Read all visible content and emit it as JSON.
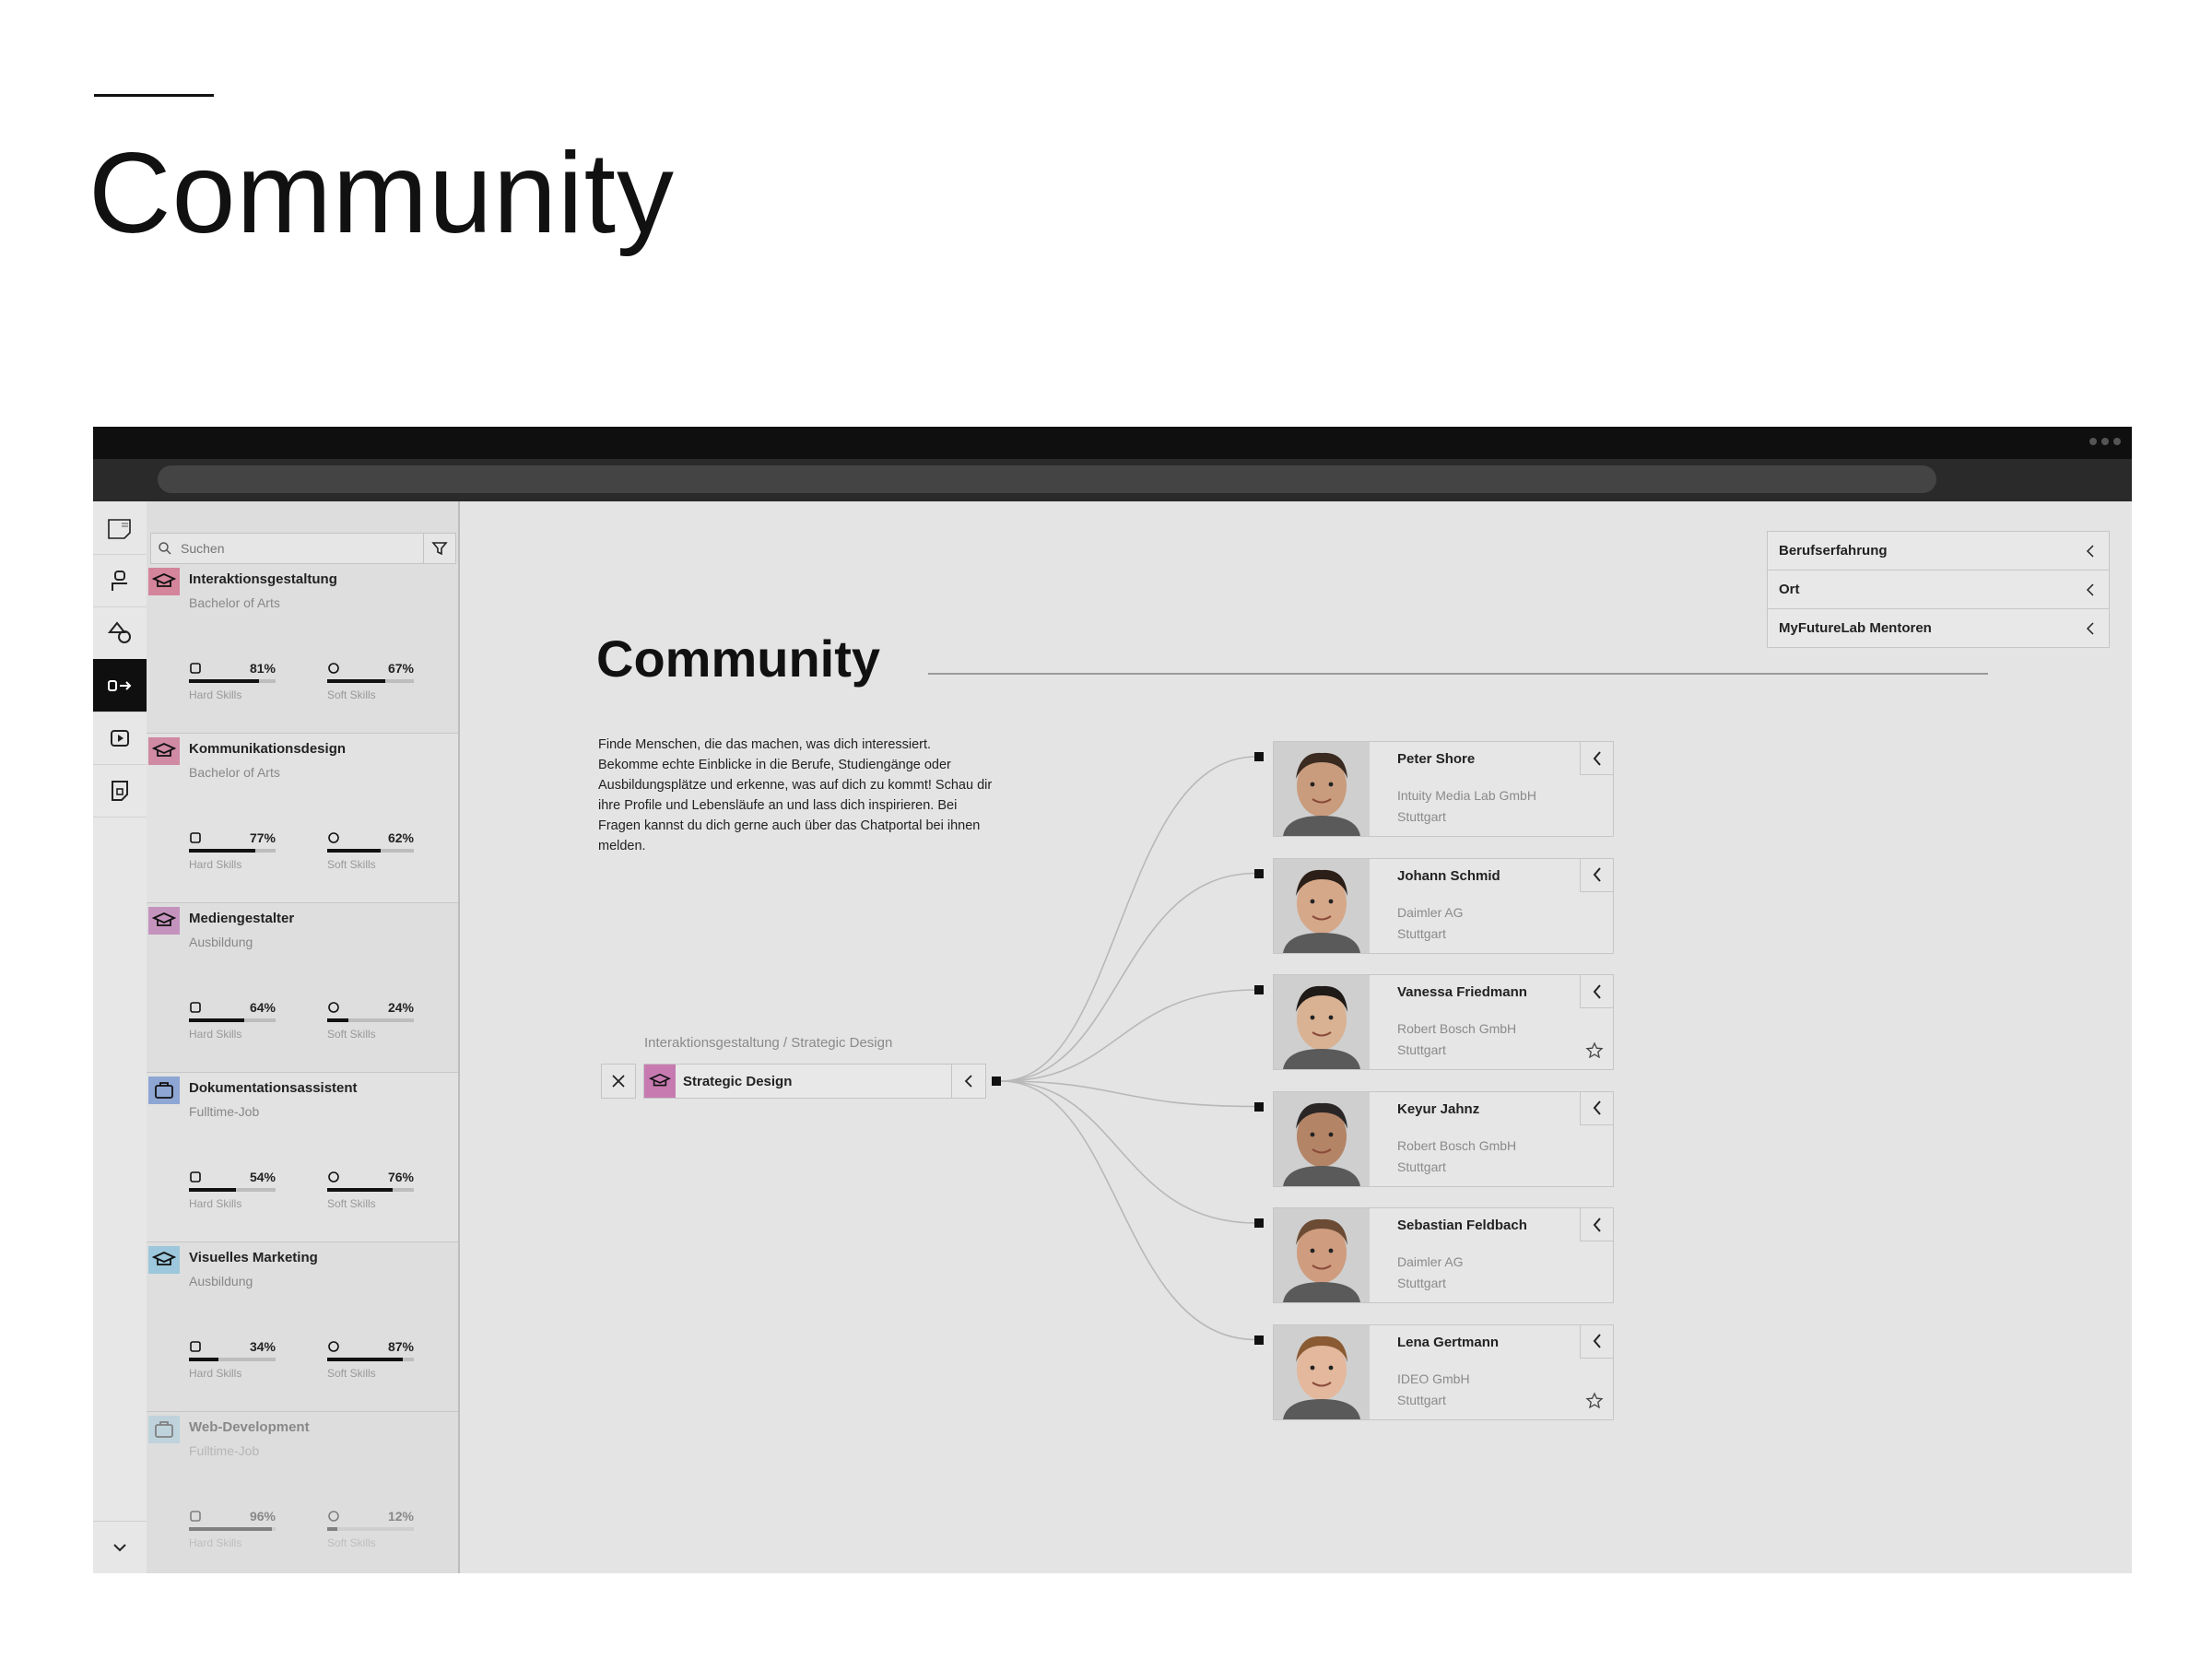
{
  "slide": {
    "title": "Community"
  },
  "app": {
    "search": {
      "placeholder": "Suchen"
    },
    "rail": [
      "logo-icon",
      "person-icon",
      "shapes-icon",
      "exit-arrow-icon",
      "play-icon",
      "bookmark-icon"
    ],
    "list": [
      {
        "title": "Interaktionsgestaltung",
        "sub": "Bachelor of Arts",
        "hard": "81%",
        "hard_val": 81,
        "soft": "67%",
        "soft_val": 67,
        "hard_label": "Hard Skills",
        "soft_label": "Soft Skills",
        "color": "#d4849b",
        "kind": "education"
      },
      {
        "title": "Kommunikationsdesign",
        "sub": "Bachelor of Arts",
        "hard": "77%",
        "hard_val": 77,
        "soft": "62%",
        "soft_val": 62,
        "hard_label": "Hard Skills",
        "soft_label": "Soft Skills",
        "color": "#d08aa3",
        "kind": "education"
      },
      {
        "title": "Mediengestalter",
        "sub": "Ausbildung",
        "hard": "64%",
        "hard_val": 64,
        "soft": "24%",
        "soft_val": 24,
        "hard_label": "Hard Skills",
        "soft_label": "Soft Skills",
        "color": "#c493bd",
        "kind": "education"
      },
      {
        "title": "Dokumentationsassistent",
        "sub": "Fulltime-Job",
        "hard": "54%",
        "hard_val": 54,
        "soft": "76%",
        "soft_val": 76,
        "hard_label": "Hard Skills",
        "soft_label": "Soft Skills",
        "color": "#8ea6d4",
        "kind": "job"
      },
      {
        "title": "Visuelles Marketing",
        "sub": "Ausbildung",
        "hard": "34%",
        "hard_val": 34,
        "soft": "87%",
        "soft_val": 87,
        "hard_label": "Hard Skills",
        "soft_label": "Soft Skills",
        "color": "#9cc7dc",
        "kind": "education"
      },
      {
        "title": "Web-Development",
        "sub": "Fulltime-Job",
        "hard": "96%",
        "hard_val": 96,
        "soft": "12%",
        "soft_val": 12,
        "hard_label": "Hard Skills",
        "soft_label": "Soft Skills",
        "color": "#9cc7dc",
        "kind": "job"
      }
    ],
    "main": {
      "title": "Community",
      "intro": "Finde Menschen, die das machen, was dich interessiert. Bekomme echte Einblicke in die Berufe, Studiengänge oder Ausbildungsplätze und erkenne, was auf dich zu kommt! Schau dir ihre Profile und Lebensläufe an und lass dich inspirieren. Bei Fragen kannst du dich gerne auch über das Chatportal bei ihnen melden.",
      "filters": [
        "Berufserfahrung",
        "Ort",
        "MyFutureLab Mentoren"
      ],
      "breadcrumb": "Interaktionsgestaltung /  Strategic Design",
      "selected": "Strategic Design",
      "mentors": [
        {
          "name": "Peter Shore",
          "company": "Intuity Media Lab GmbH",
          "city": "Stuttgart",
          "star": false,
          "skin": "#c99c7e",
          "hair": "#3a2a20"
        },
        {
          "name": "Johann Schmid",
          "company": "Daimler AG",
          "city": "Stuttgart",
          "star": false,
          "skin": "#d6a88a",
          "hair": "#2b1f18"
        },
        {
          "name": "Vanessa Friedmann",
          "company": "Robert Bosch GmbH",
          "city": "Stuttgart",
          "star": true,
          "skin": "#d9b293",
          "hair": "#1f1a17"
        },
        {
          "name": "Keyur Jahnz",
          "company": "Robert Bosch GmbH",
          "city": "Stuttgart",
          "star": false,
          "skin": "#b48466",
          "hair": "#2a2626"
        },
        {
          "name": "Sebastian Feldbach",
          "company": "Daimler AG",
          "city": "Stuttgart",
          "star": false,
          "skin": "#cf9c7f",
          "hair": "#6b4b34"
        },
        {
          "name": "Lena Gertmann",
          "company": "IDEO GmbH",
          "city": "Stuttgart",
          "star": true,
          "skin": "#e3b89d",
          "hair": "#8a5a33"
        }
      ]
    }
  }
}
